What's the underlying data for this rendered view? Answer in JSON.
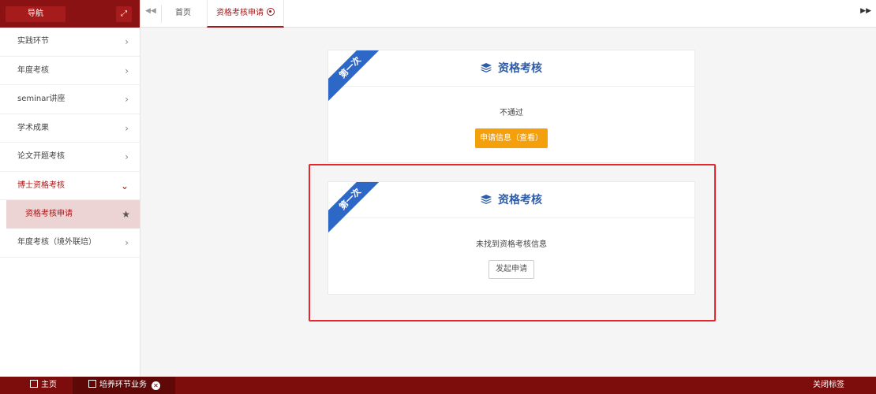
{
  "sidebar": {
    "title": "导航",
    "expand_icon": "expand-arrows-icon",
    "items": [
      {
        "label": "实践环节"
      },
      {
        "label": "年度考核"
      },
      {
        "label": "seminar讲座"
      },
      {
        "label": "学术成果"
      },
      {
        "label": "论文开题考核"
      },
      {
        "label": "博士资格考核"
      },
      {
        "label": "年度考核（境外联培）"
      }
    ],
    "sub_item": {
      "label": "资格考核申请"
    }
  },
  "tabs": {
    "home": "首页",
    "active": "资格考核申请"
  },
  "cards": [
    {
      "ribbon": "第一次",
      "title": "资格考核",
      "status": "不通过",
      "button": "申请信息（查看）"
    },
    {
      "ribbon": "第一次",
      "title": "资格考核",
      "status": "未找到资格考核信息",
      "button": "发起申请"
    }
  ],
  "bottombar": {
    "home": "主页",
    "tab": "培养环节业务",
    "close_tabs": "关闭标签"
  },
  "colors": {
    "brand": "#8b1212",
    "accent_blue": "#2e5ca8",
    "orange": "#f3a00c",
    "highlight": "#e8262d"
  }
}
